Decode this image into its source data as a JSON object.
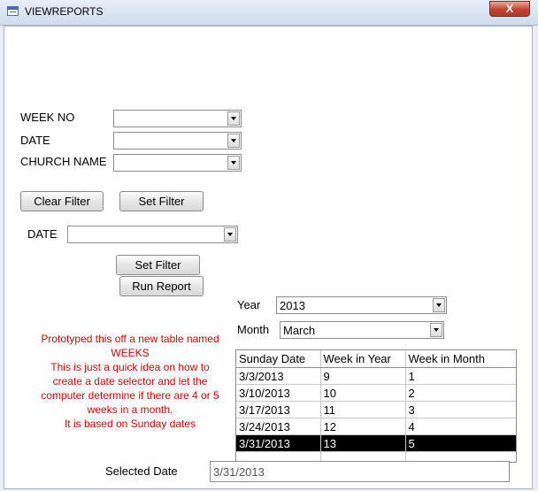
{
  "window": {
    "title": "VIEWREPORTS",
    "close_label": "X"
  },
  "filters": {
    "week_no_label": "WEEK NO",
    "date_label": "DATE",
    "church_name_label": "CHURCH NAME",
    "week_no_value": "",
    "date_value": "",
    "church_name_value": "",
    "clear_filter_label": "Clear Filter",
    "set_filter_label": "Set Filter"
  },
  "date_filter": {
    "label": "DATE",
    "value": "",
    "set_filter_label": "Set Filter",
    "run_report_label": "Run Report"
  },
  "selector": {
    "year_label": "Year",
    "year_value": "2013",
    "month_label": "Month",
    "month_value": "March"
  },
  "note": {
    "lines": [
      "Prototyped this off a new table named",
      "WEEKS",
      "This is just a quick idea on how to",
      "create a date selector and let the",
      "computer determine if there are 4 or 5",
      "weeks in a month.",
      "It is based on Sunday dates"
    ]
  },
  "weeks_table": {
    "columns": [
      "Sunday Date",
      "Week in Year",
      "Week in Month"
    ],
    "rows": [
      [
        "3/3/2013",
        "9",
        "1"
      ],
      [
        "3/10/2013",
        "10",
        "2"
      ],
      [
        "3/17/2013",
        "11",
        "3"
      ],
      [
        "3/24/2013",
        "12",
        "4"
      ],
      [
        "3/31/2013",
        "13",
        "5"
      ]
    ],
    "selected_row": 4
  },
  "selected_date": {
    "label": "Selected Date",
    "value": "3/31/2013"
  },
  "colors": {
    "note_text": "#e60000",
    "selected_row_bg": "#000000",
    "close_button": "#c2412f"
  }
}
